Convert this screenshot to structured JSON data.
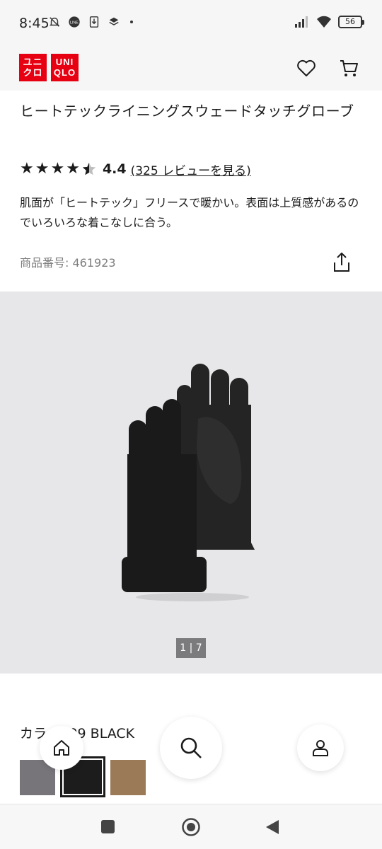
{
  "status_bar": {
    "time": "8:45",
    "battery": "56"
  },
  "header": {
    "logo_left": "ユニ\nクロ",
    "logo_right": "UNI\nQLO",
    "brand_color": "#e60012",
    "icons": [
      "heart-icon",
      "cart-icon"
    ]
  },
  "product": {
    "title": "ヒートテックライニングスウェードタッチグローブ",
    "rating_value": "4.4",
    "reviews_link": "(325 レビューを見る)",
    "description": "肌面が「ヒートテック」フリースで暖かい。表面は上質感があるのでいろいろな着こなしに合う。",
    "product_number": "商品番号: 461923"
  },
  "gallery": {
    "counter": "1 | 7"
  },
  "color": {
    "label": "カラー: 09 BLACK",
    "swatches": [
      {
        "name": "gray",
        "color": "#77747a"
      },
      {
        "name": "black",
        "color": "#1c1c1c",
        "selected": true
      },
      {
        "name": "brown",
        "color": "#9b7a58"
      }
    ]
  },
  "floating_nav": {
    "icons": [
      "home-icon",
      "search-icon",
      "account-icon"
    ]
  },
  "android_nav": {
    "icons": [
      "recents-icon",
      "home-circle-icon",
      "back-icon"
    ]
  }
}
